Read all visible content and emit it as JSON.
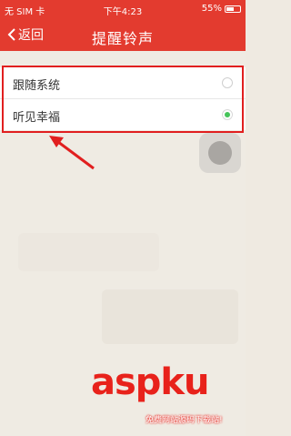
{
  "statusbar": {
    "carrier": "无 SIM 卡",
    "time": "下午4:23",
    "battery": "55%",
    "battery_level": 0.55
  },
  "navbar": {
    "back_label": "返回",
    "title": "提醒铃声"
  },
  "options": [
    {
      "label": "跟随系统",
      "selected": false
    },
    {
      "label": "听见幸福",
      "selected": true
    }
  ],
  "watermark": {
    "logo": "aspku",
    "slogan": "免费网站源码下载站!"
  },
  "colors": {
    "brand": "#e33b2f",
    "highlight": "#e11f1f",
    "radio_on": "#46c45a"
  }
}
